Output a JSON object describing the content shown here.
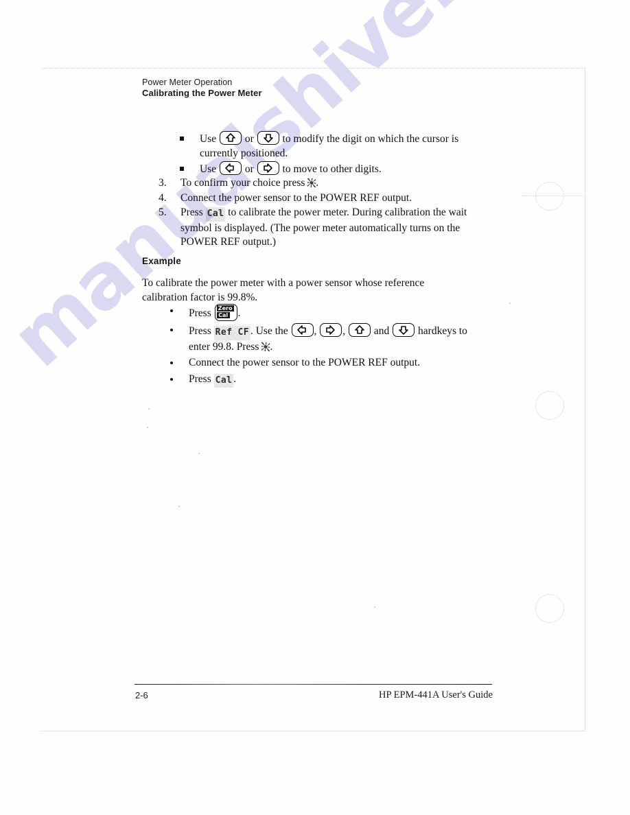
{
  "document": {
    "running_head": {
      "chapter": "Power Meter Operation",
      "section": "Calibrating the Power Meter"
    },
    "footer": {
      "page_number": "2-6",
      "guide_title": "HP EPM-441A User's Guide"
    },
    "watermark": "manualshive.com"
  },
  "sub_bullets": [
    {
      "marker": "square",
      "parts": [
        {
          "type": "text",
          "value": "Use "
        },
        {
          "type": "hardkey",
          "icon": "arrow-up-key",
          "value": "△"
        },
        {
          "type": "text",
          "value": " or "
        },
        {
          "type": "hardkey",
          "icon": "arrow-down-key",
          "value": "▽"
        },
        {
          "type": "text",
          "value": " to modify the digit on which the cursor is currently positioned."
        }
      ]
    },
    {
      "marker": "square",
      "parts": [
        {
          "type": "text",
          "value": "Use "
        },
        {
          "type": "hardkey",
          "icon": "arrow-left-key",
          "value": "◁"
        },
        {
          "type": "text",
          "value": " or "
        },
        {
          "type": "hardkey",
          "icon": "arrow-right-key",
          "value": "▷"
        },
        {
          "type": "text",
          "value": " to move to other digits."
        }
      ]
    }
  ],
  "numbered_steps": [
    {
      "number": "3.",
      "parts": [
        {
          "type": "text",
          "value": "To confirm your choice press "
        },
        {
          "type": "softkey-pct",
          "icon": "percent-softkey",
          "value": "%"
        },
        {
          "type": "text",
          "value": "."
        }
      ]
    },
    {
      "number": "4.",
      "parts": [
        {
          "type": "text",
          "value": "Connect the power sensor to the POWER REF output."
        }
      ]
    },
    {
      "number": "5.",
      "parts": [
        {
          "type": "text",
          "value": "Press "
        },
        {
          "type": "softkey",
          "icon": "cal-softkey",
          "value": "Cal"
        },
        {
          "type": "text",
          "value": " to calibrate the power meter. During calibration the wait symbol is displayed. (The power meter automatically turns on the POWER REF output.)"
        }
      ]
    }
  ],
  "example": {
    "heading": "Example",
    "intro": "To calibrate the power meter with a power sensor whose reference calibration factor is 99.8%.",
    "bullets": [
      {
        "marker": "round",
        "parts": [
          {
            "type": "text",
            "value": "Press "
          },
          {
            "type": "hardkey-zerocal",
            "icon": "zero-cal-key",
            "top": "Zero",
            "bottom": "Cal"
          },
          {
            "type": "text",
            "value": "."
          }
        ]
      },
      {
        "marker": "round",
        "parts": [
          {
            "type": "text",
            "value": "Press "
          },
          {
            "type": "softkey",
            "icon": "ref-cf-softkey",
            "value": "Ref CF"
          },
          {
            "type": "text",
            "value": ". Use the "
          },
          {
            "type": "hardkey",
            "icon": "arrow-left-key",
            "value": "◁"
          },
          {
            "type": "text",
            "value": ", "
          },
          {
            "type": "hardkey",
            "icon": "arrow-right-key",
            "value": "▷"
          },
          {
            "type": "text",
            "value": ", "
          },
          {
            "type": "hardkey",
            "icon": "arrow-up-key",
            "value": "△"
          },
          {
            "type": "text",
            "value": " and "
          },
          {
            "type": "hardkey",
            "icon": "arrow-down-key",
            "value": "▽"
          },
          {
            "type": "text",
            "value": " hardkeys to enter 99.8. Press "
          },
          {
            "type": "softkey-pct",
            "icon": "percent-softkey",
            "value": "%"
          },
          {
            "type": "text",
            "value": "."
          }
        ]
      },
      {
        "marker": "round",
        "parts": [
          {
            "type": "text",
            "value": "Connect the power sensor to the POWER REF output."
          }
        ]
      },
      {
        "marker": "round",
        "parts": [
          {
            "type": "text",
            "value": "Press "
          },
          {
            "type": "softkey",
            "icon": "cal-softkey",
            "value": "Cal"
          },
          {
            "type": "text",
            "value": "."
          }
        ]
      }
    ]
  }
}
